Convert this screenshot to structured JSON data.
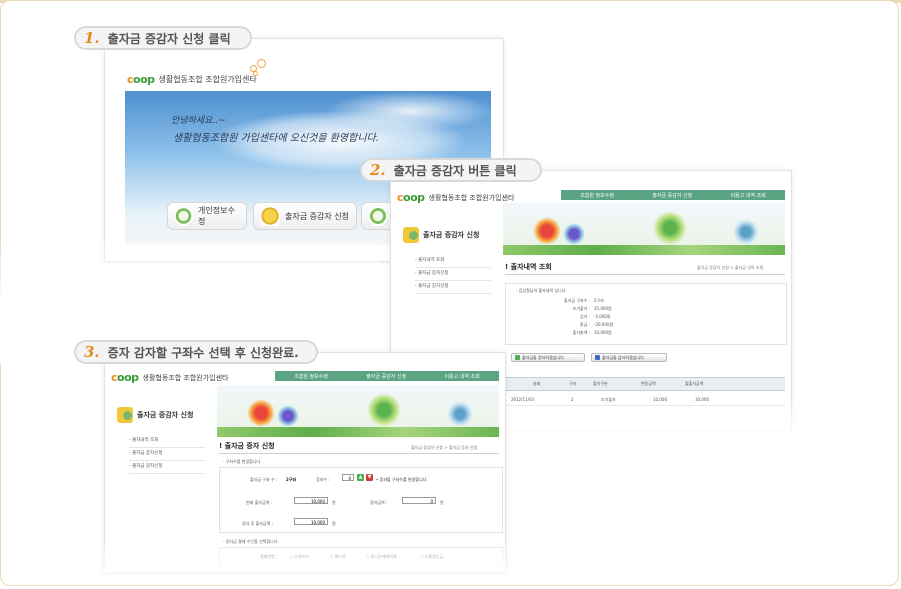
{
  "steps": [
    {
      "num": "1.",
      "label": "출자금 증감자 신청 클릭"
    },
    {
      "num": "2.",
      "label": "출자금 증감자 버튼 클릭"
    },
    {
      "num": "3.",
      "label": "증자 감자할 구좌수 선택 후 신청완료."
    }
  ],
  "brand": {
    "coop": "coop",
    "org": "생활협동조합 조합원가입센타"
  },
  "panel1": {
    "greeting_1": "안녕하세요..~",
    "greeting_2": "생활협동조합원 가입센타에 오신것을 환영합니다.",
    "buttons": [
      "개인정보수정",
      "출자금 증감자 신청"
    ]
  },
  "nav": [
    "조합원 정보수정",
    "출자금 증감자 신청",
    "이용고 내역 조회"
  ],
  "panel2": {
    "side_title": "출자금 증감자 신청",
    "side_menu": [
      "출자내역 조회",
      "출자금 증자신청",
      "출자금 감자신청"
    ],
    "page_title": "출자내역 조회",
    "crumb": "출자금 증감자 신청 > 출자금 내역 조회",
    "summary_head": "김상철님의 출자내역 입니다.",
    "summary": [
      {
        "label": "출자금 구좌수 :",
        "value": "2구좌"
      },
      {
        "label": "조기출자 :",
        "value": "35,000원"
      },
      {
        "label": "감자 :",
        "value": "-5,000원"
      },
      {
        "label": "환급 :",
        "value": "-20,000원"
      },
      {
        "label": "출자총액 :",
        "value": "10,000원"
      }
    ],
    "btn_increase": "출자금을 증자하겠습니다",
    "btn_decrease": "출자금을 감자하겠습니다",
    "table_headers": [
      "날짜",
      "구좌",
      "출자구분",
      "변동금액",
      "출출자금액"
    ],
    "table_rows": [
      [
        "2012/11/03",
        "2",
        "조기출자",
        "10,000",
        "10,000"
      ]
    ]
  },
  "panel3": {
    "side_title": "출자금 증감자 신청",
    "side_menu": [
      "출자내역 조회",
      "출자금 증자신청",
      "출자금 감자신청"
    ],
    "page_title": "출자금 증자 신청",
    "crumb": "출자금 증감자 신청 > 출자금 증자 신청",
    "section1": "구좌수를 변경합니다.",
    "account_label": "출자금 구좌 수 :",
    "account_value": "2구좌",
    "add_label": "증좌수 :",
    "add_value": "0",
    "add_note": "증좌할 구좌수를 변경합니다.",
    "current_label": "현재 출자금액 :",
    "current_value": "10,000",
    "increase_label": "증자금액 :",
    "increase_value": "0",
    "after_label": "증자 후 출자금액 :",
    "after_value": "10,000",
    "unit": "원",
    "section2": "증자금 결제 수단을 선택합니다.",
    "pay_label": "결제방법 :",
    "pay_options": [
      "신용카드",
      "핸드폰",
      "실시간계좌이체",
      "무통장입금"
    ]
  }
}
